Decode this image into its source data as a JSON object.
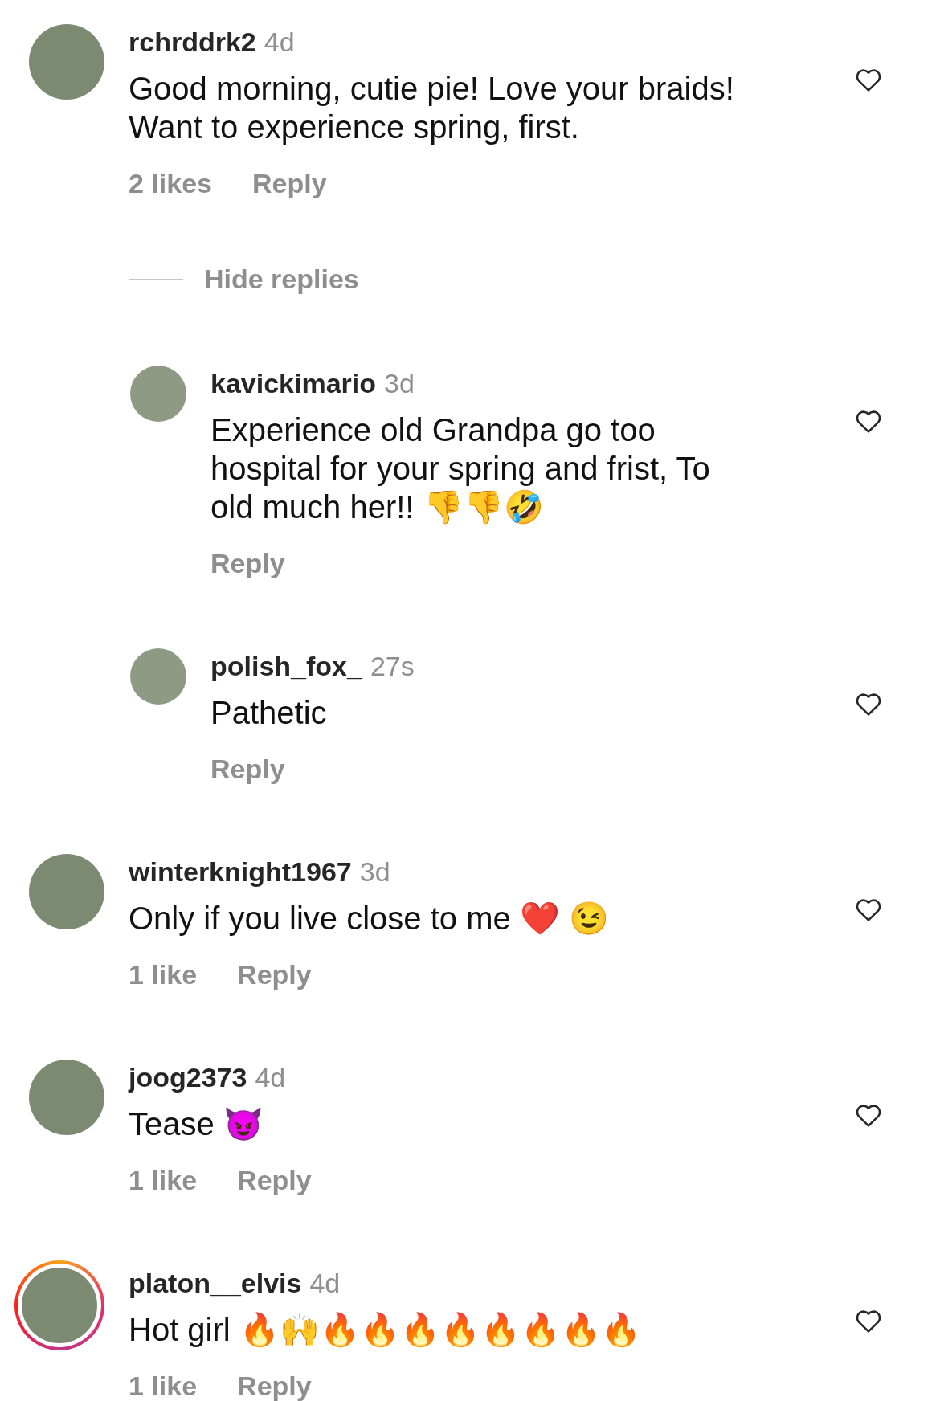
{
  "comments": [
    {
      "username": "rchrddrk2",
      "time": "4d",
      "text": [
        "Good morning, cutie pie!  Love your braids!",
        "Want to experience spring, first."
      ],
      "likes": "2 likes",
      "reply": "Reply",
      "story_ring": false,
      "hide_replies": "Hide replies",
      "replies": [
        {
          "username": "kavickimario",
          "time": "3d",
          "text": [
            "Experience old Grandpa go too",
            "hospital for your spring and frist, To",
            "old much her!! 👎👎🤣"
          ],
          "reply": "Reply"
        },
        {
          "username": "polish_fox_",
          "time": "27s",
          "text": [
            "Pathetic"
          ],
          "reply": "Reply"
        }
      ]
    },
    {
      "username": "winterknight1967",
      "time": "3d",
      "text": [
        "Only if you live close to me ❤️ 😉"
      ],
      "likes": "1 like",
      "reply": "Reply",
      "story_ring": false
    },
    {
      "username": "joog2373",
      "time": "4d",
      "text": [
        "Tease 😈"
      ],
      "likes": "1 like",
      "reply": "Reply",
      "story_ring": false
    },
    {
      "username": "platon__elvis",
      "time": "4d",
      "text": [
        "Hot girl 🔥🙌🔥🔥🔥🔥🔥🔥🔥🔥"
      ],
      "likes": "1 like",
      "reply": "Reply",
      "story_ring": true
    }
  ]
}
